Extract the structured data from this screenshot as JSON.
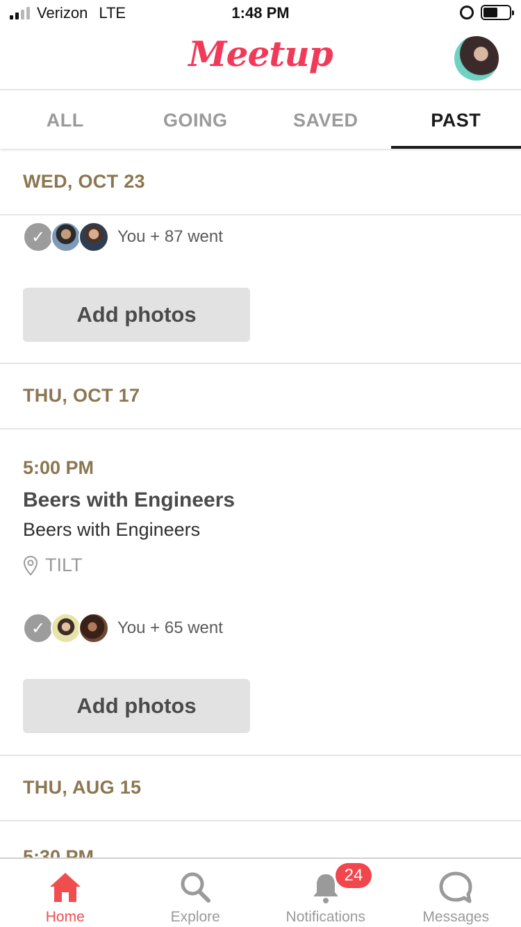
{
  "status_bar": {
    "carrier": "Verizon",
    "network": "LTE",
    "time": "1:48 PM",
    "battery_level": 0.55
  },
  "header": {
    "logo_text": "Meetup",
    "avatar_icon": "user-avatar"
  },
  "tabs": [
    {
      "label": "ALL",
      "active": false
    },
    {
      "label": "GOING",
      "active": false
    },
    {
      "label": "SAVED",
      "active": false
    },
    {
      "label": "PAST",
      "active": true
    }
  ],
  "sections": [
    {
      "date": "WED, OCT 23",
      "event": {
        "attendees_text": "You + 87 went",
        "button_label": "Add photos"
      }
    },
    {
      "date": "THU, OCT 17",
      "event": {
        "time": "5:00 PM",
        "title": "Beers with Engineers",
        "group": "Beers with Engineers",
        "venue": "TILT",
        "attendees_text": "You + 65 went",
        "button_label": "Add photos"
      }
    },
    {
      "date": "THU, AUG 15",
      "event": {
        "time": "5:30 PM"
      }
    }
  ],
  "bottom_nav": {
    "items": [
      {
        "label": "Home",
        "icon": "home-icon",
        "active": true
      },
      {
        "label": "Explore",
        "icon": "search-icon",
        "active": false
      },
      {
        "label": "Notifications",
        "icon": "bell-icon",
        "active": false,
        "badge": "24"
      },
      {
        "label": "Messages",
        "icon": "chat-bubble-icon",
        "active": false
      }
    ]
  },
  "colors": {
    "brand": "#f13a59",
    "date_text": "#8b7650",
    "active_nav": "#f04e4e",
    "badge": "#f0464c"
  }
}
